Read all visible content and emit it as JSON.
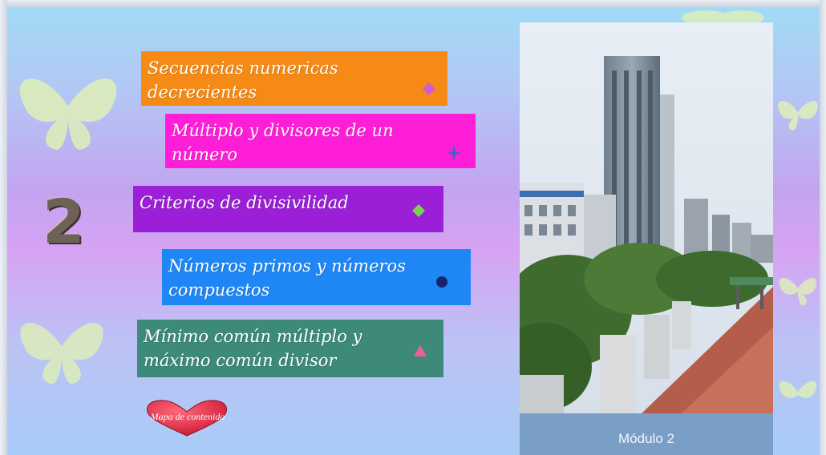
{
  "slide": {
    "number": "2",
    "caption": "Módulo 2",
    "back_button": "Mapa de contenido"
  },
  "menu": [
    {
      "label": "Secuencias numericas decrecientes",
      "bg": "#f58a16",
      "bullet": "diamond",
      "bullet_color": "#d25ad8"
    },
    {
      "label": "Múltiplo y divisores de un número",
      "bg": "#ff1ed7",
      "bullet": "star4",
      "bullet_color": "#4a5fcf"
    },
    {
      "label": "Criterios de divisivilidad",
      "bg": "#9a1fd6",
      "bullet": "diamond",
      "bullet_color": "#7fcf55"
    },
    {
      "label": "Números primos y números compuestos",
      "bg": "#1f86f5",
      "bullet": "circle",
      "bullet_color": "#16246e"
    },
    {
      "label": "Mínimo común múltiplo y máximo común divisor",
      "bg": "#3e8a7a",
      "bullet": "triangle",
      "bullet_color": "#f25a9a"
    }
  ],
  "icons": {
    "numeral": "number-2-icon",
    "photo": "city-photo",
    "back": "heart-button-icon"
  }
}
